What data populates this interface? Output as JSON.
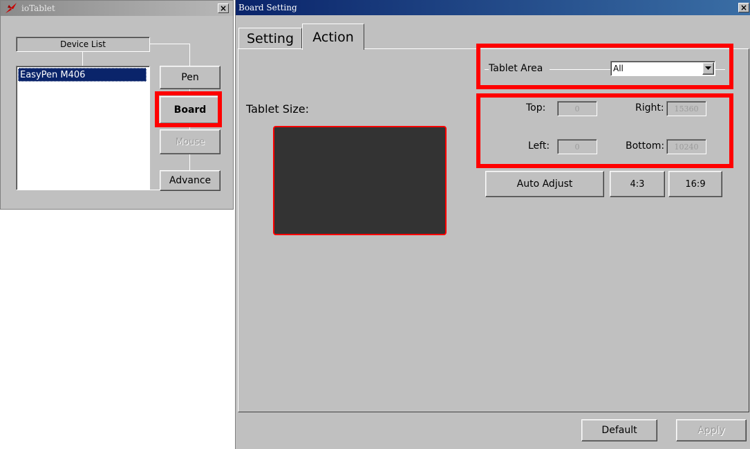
{
  "left_window": {
    "title": "ioTablet",
    "close_glyph": "×",
    "device_list_label": "Device List",
    "devices": [
      "EasyPen M406"
    ],
    "buttons": {
      "pen": "Pen",
      "board": "Board",
      "mouse": "Mouse",
      "advance": "Advance"
    }
  },
  "right_window": {
    "title": "Board Setting",
    "close_glyph": "×",
    "tabs": [
      "Setting",
      "Action"
    ],
    "tablet_size_label": "Tablet Size:",
    "tablet_area_label": "Tablet Area",
    "tablet_area_value": "All",
    "fields": {
      "top_label": "Top:",
      "top_value": "0",
      "right_label": "Right:",
      "right_value": "15360",
      "left_label": "Left:",
      "left_value": "0",
      "bottom_label": "Bottom:",
      "bottom_value": "10240"
    },
    "buttons": {
      "auto_adjust": "Auto Adjust",
      "ratio_43": "4:3",
      "ratio_169": "16:9",
      "default": "Default",
      "apply": "Apply"
    }
  },
  "colors": {
    "highlight": "#ff0000",
    "selection": "#0a246a",
    "tablet_preview": "#333333",
    "dialog_face": "#c0c0c0"
  },
  "icons": {
    "app_logo": "pen-nib-icon",
    "close": "close-icon",
    "dropdown": "chevron-down-icon"
  }
}
